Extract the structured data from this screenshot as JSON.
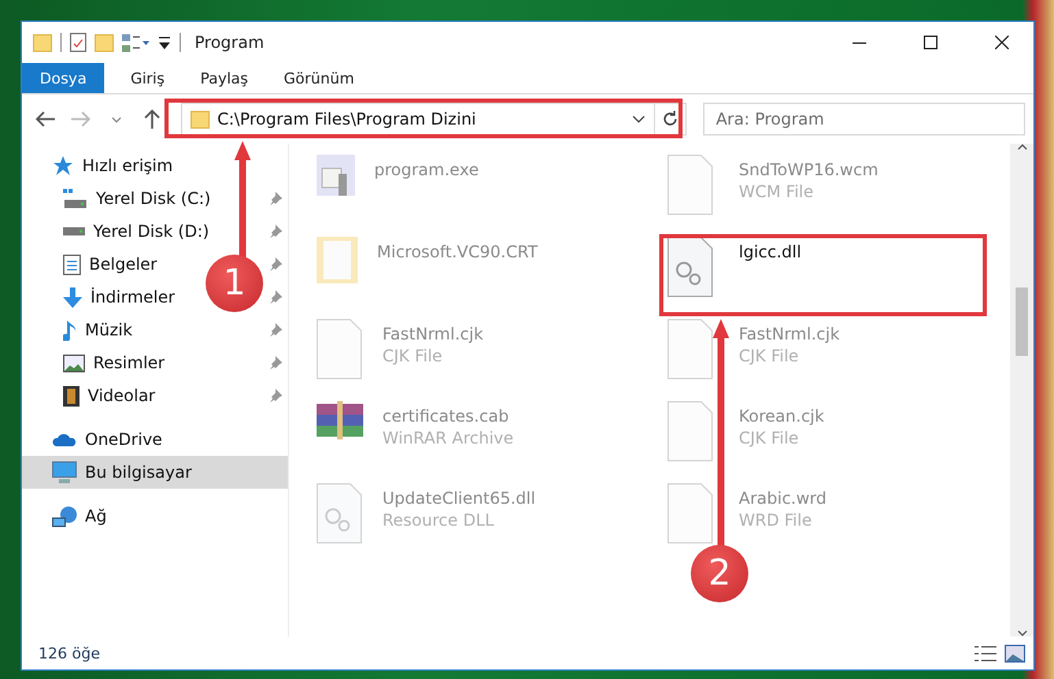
{
  "window": {
    "title": "Program"
  },
  "ribbon_tabs": [
    {
      "label": "Dosya",
      "selected": true
    },
    {
      "label": "Giriş",
      "selected": false
    },
    {
      "label": "Paylaş",
      "selected": false
    },
    {
      "label": "Görünüm",
      "selected": false
    }
  ],
  "address": {
    "path": "C:\\Program Files\\Program Dizini"
  },
  "search": {
    "placeholder": "Ara: Program"
  },
  "sidebar": {
    "items": [
      {
        "label": "Hızlı erişim",
        "kind": "star",
        "selected": false,
        "children": [
          {
            "label": "Yerel Disk (C:)",
            "kind": "system-drive",
            "pinned": true,
            "selected": false
          },
          {
            "label": "Yerel Disk (D:)",
            "kind": "drive",
            "pinned": true,
            "selected": false
          },
          {
            "label": "Belgeler",
            "kind": "document",
            "pinned": true,
            "selected": false
          },
          {
            "label": "İndirmeler",
            "kind": "download",
            "pinned": true,
            "selected": false
          },
          {
            "label": "Müzik",
            "kind": "music",
            "pinned": true,
            "selected": false
          },
          {
            "label": "Resimler",
            "kind": "image",
            "pinned": true,
            "selected": false
          },
          {
            "label": "Videolar",
            "kind": "video",
            "pinned": true,
            "selected": false
          }
        ]
      },
      {
        "label": "OneDrive",
        "kind": "cloud",
        "selected": false
      },
      {
        "label": "Bu bilgisayar",
        "kind": "computer",
        "selected": true
      },
      {
        "label": "Ağ",
        "kind": "network",
        "selected": false
      }
    ]
  },
  "files": [
    {
      "name": "program.exe",
      "kind": "exe",
      "highlighted": false
    },
    {
      "name": "SndToWP16.wcm",
      "type": "WCM File",
      "kind": "file",
      "highlighted": false
    },
    {
      "name": "Microsoft.VC90.CRT",
      "kind": "folder",
      "highlighted": false
    },
    {
      "name": "lgicc.dll",
      "kind": "dll",
      "highlighted": true
    },
    {
      "name": "FastNrml.cjk",
      "type": "CJK File",
      "kind": "file",
      "highlighted": false
    },
    {
      "name": "FastNrml.cjk",
      "type": "CJK File",
      "kind": "file",
      "highlighted": false
    },
    {
      "name": "certificates.cab",
      "type": "WinRAR Archive",
      "kind": "archive",
      "highlighted": false
    },
    {
      "name": "Korean.cjk",
      "type": "CJK File",
      "kind": "file",
      "highlighted": false
    },
    {
      "name": "UpdateClient65.dll",
      "type": "Resource DLL",
      "kind": "dll",
      "highlighted": false
    },
    {
      "name": "Arabic.wrd",
      "type": "WRD File",
      "kind": "file",
      "highlighted": false
    }
  ],
  "status_bar": {
    "count": "126 öğe"
  },
  "annotations": [
    {
      "number": "1"
    },
    {
      "number": "2"
    }
  ]
}
